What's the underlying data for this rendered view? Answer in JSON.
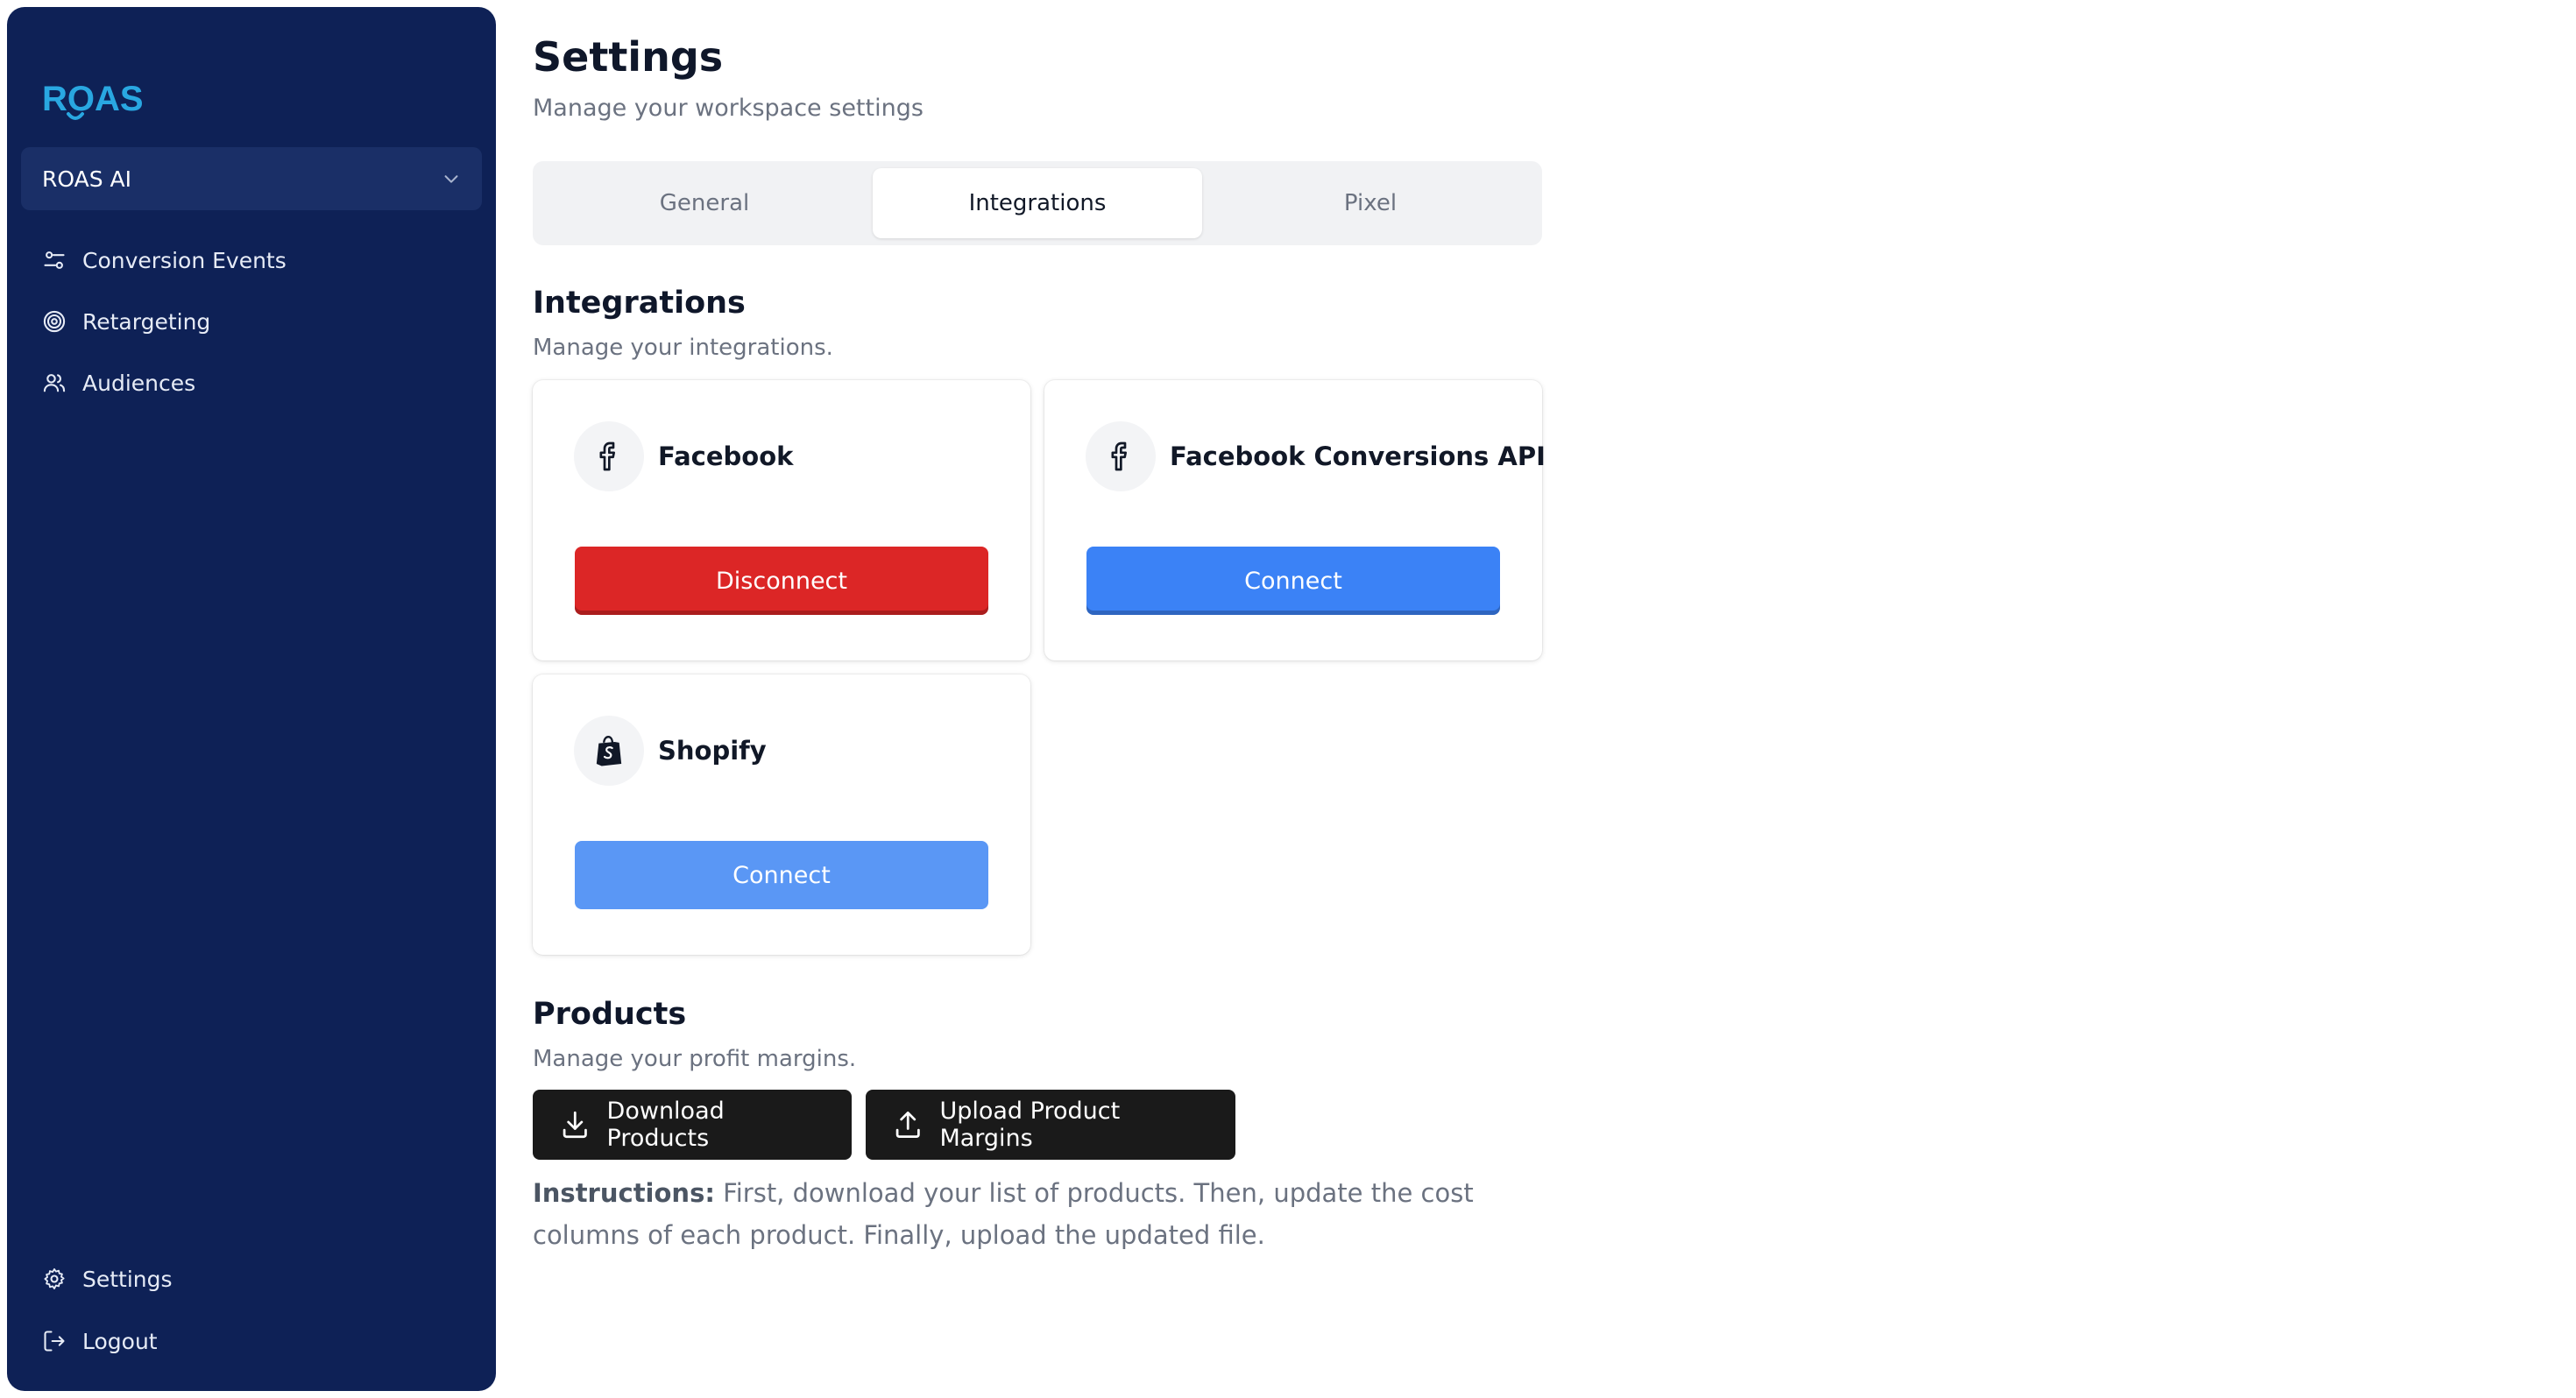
{
  "app": {
    "logo_text": "ROAS",
    "brand_color": "#29a7e1"
  },
  "sidebar": {
    "workspace": {
      "name": "ROAS AI",
      "icon": "chevron-down-icon"
    },
    "items": [
      {
        "label": "Conversion Events",
        "icon": "sliders-icon"
      },
      {
        "label": "Retargeting",
        "icon": "target-icon"
      },
      {
        "label": "Audiences",
        "icon": "users-icon"
      }
    ],
    "footer": [
      {
        "label": "Settings",
        "icon": "gear-icon"
      },
      {
        "label": "Logout",
        "icon": "logout-icon"
      }
    ],
    "background": "#0e2156"
  },
  "header": {
    "title": "Settings",
    "subtitle": "Manage your workspace settings"
  },
  "tabs": [
    {
      "label": "General",
      "active": false
    },
    {
      "label": "Integrations",
      "active": true
    },
    {
      "label": "Pixel",
      "active": false
    }
  ],
  "integrations": {
    "title": "Integrations",
    "subtitle": "Manage your integrations.",
    "cards": [
      {
        "name": "Facebook",
        "icon": "facebook-icon",
        "button": "Disconnect",
        "button_color": "#dc2626"
      },
      {
        "name": "Facebook Conversions API",
        "icon": "facebook-icon",
        "button": "Connect",
        "button_color": "#3b82f6"
      },
      {
        "name": "Shopify",
        "icon": "shopify-bag-icon",
        "button": "Connect",
        "button_color": "#5a97f5"
      }
    ]
  },
  "products": {
    "title": "Products",
    "subtitle": "Manage your profit margins.",
    "download_label": "Download Products",
    "upload_label": "Upload Product Margins",
    "instructions_label": "Instructions:",
    "instructions_text": " First, download your list of products. Then, update the cost columns of each product. Finally, upload the updated file."
  }
}
